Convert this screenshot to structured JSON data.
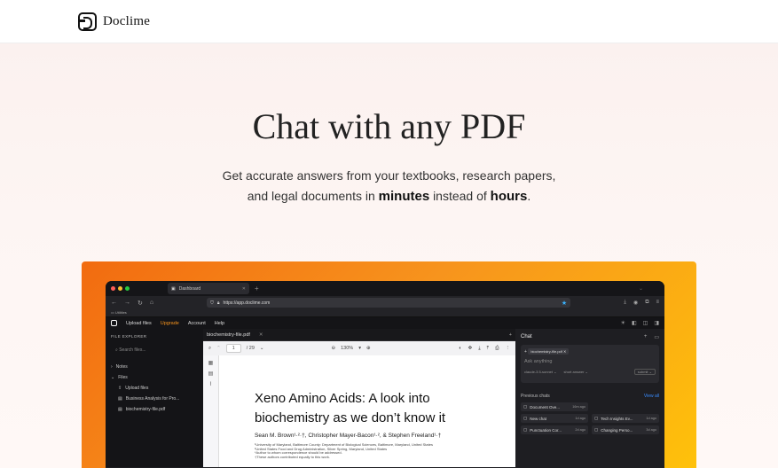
{
  "header": {
    "brand": "Doclime"
  },
  "hero": {
    "title": "Chat with any PDF",
    "line1": "Get accurate answers from your textbooks, research papers,",
    "line2_a": "and legal documents in",
    "line2_b": "minutes",
    "line2_c": "instead of",
    "line2_d": "hours",
    "line2_e": "."
  },
  "browser": {
    "tab_title": "Dashboard",
    "url": "https://app.doclime.com",
    "bookmark": "Utilities"
  },
  "app": {
    "menu": [
      "Upload files",
      "Upgrade",
      "Account",
      "Help"
    ]
  },
  "explorer": {
    "heading": "FILE EXPLORER",
    "search_placeholder": "Search files...",
    "notes": "Notes",
    "files": "Files",
    "upload": "Upload files",
    "file1": "Business Analysis for Pro...",
    "file2": "biochemistry-file.pdf"
  },
  "viewer": {
    "tab": "biochemistry-file.pdf",
    "page": "1",
    "page_total": "/ 29",
    "zoom": "130%",
    "doc_title_l1": "Xeno Amino Acids: A look into",
    "doc_title_l2": "biochemistry as we don’t know it",
    "authors": "Sean M. Brown¹·²·†, Christopher Mayer-Bacon¹·², & Stephen Freeland¹·†",
    "note1": "¹University of Maryland, Baltimore County: Department of Biological Sciences, Baltimore, Maryland, United States",
    "note2": "²United States Food and Drug Administration, Silver Spring, Maryland, United States",
    "note3": "*Author to whom correspondence should be addressed.",
    "note4": "†These authors contributed equally to this work."
  },
  "chat": {
    "title": "Chat",
    "file_chip": "biochemistry-file.pdf",
    "ask_placeholder": "Ask anything",
    "model": "claude-3.5-sonnet",
    "answer_len": "short answer",
    "submit": "submit",
    "prev_heading": "Previous chats",
    "view_all": "View all",
    "prev": [
      {
        "label": "Document Ove...",
        "ago": "16m ago"
      },
      {
        "label": "New chat",
        "ago": "1d ago"
      },
      {
        "label": "Tech Insights Ev...",
        "ago": "1d ago"
      },
      {
        "label": "Punctuation Cor...",
        "ago": "2d ago"
      },
      {
        "label": "Changing Perso...",
        "ago": "3d ago"
      }
    ]
  }
}
